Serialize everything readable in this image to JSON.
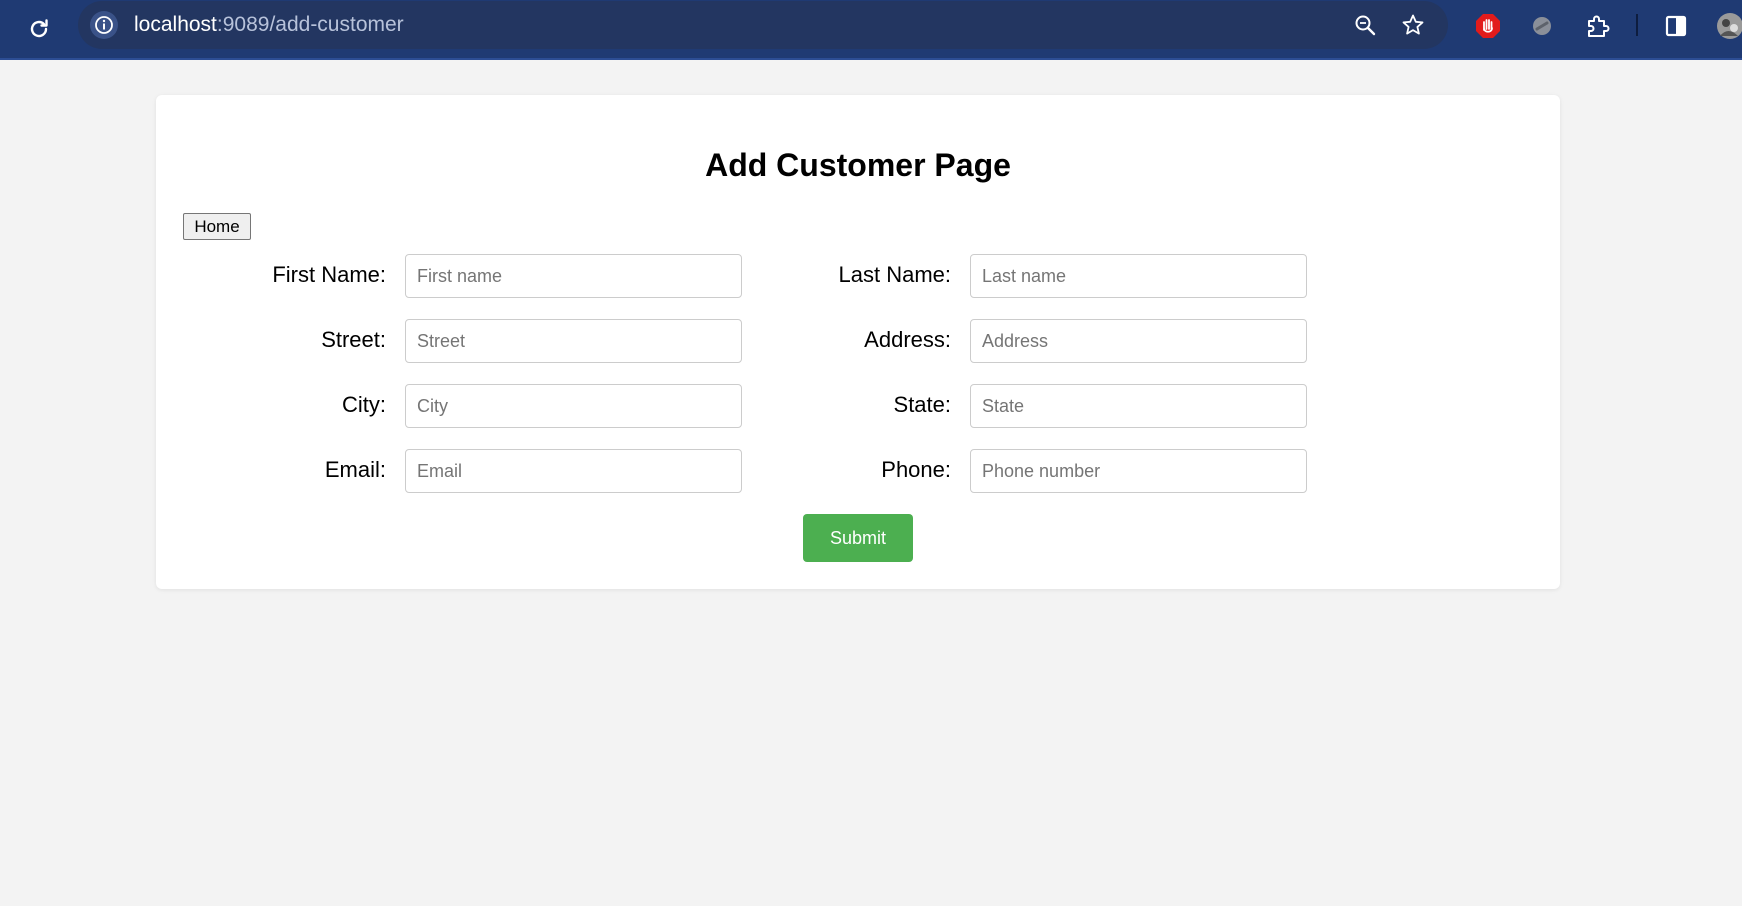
{
  "browser": {
    "url_host": "localhost",
    "url_path": ":9089/add-customer",
    "icons": {
      "reload": "reload-icon",
      "info": "info-icon",
      "zoom": "zoom-icon",
      "bookmark": "bookmark-star-icon",
      "extension1": "stop-hand-extension-icon",
      "extension2": "gray-extension-icon",
      "extensions": "puzzle-extensions-icon",
      "sidepanel": "side-panel-icon",
      "profile": "profile-avatar-icon"
    }
  },
  "page": {
    "title": "Add Customer Page",
    "home_button": "Home",
    "submit_button": "Submit",
    "fields": {
      "first_name": {
        "label": "First Name:",
        "placeholder": "First name"
      },
      "last_name": {
        "label": "Last Name:",
        "placeholder": "Last name"
      },
      "street": {
        "label": "Street:",
        "placeholder": "Street"
      },
      "address": {
        "label": "Address:",
        "placeholder": "Address"
      },
      "city": {
        "label": "City:",
        "placeholder": "City"
      },
      "state": {
        "label": "State:",
        "placeholder": "State"
      },
      "email": {
        "label": "Email:",
        "placeholder": "Email"
      },
      "phone": {
        "label": "Phone:",
        "placeholder": "Phone number"
      }
    }
  },
  "colors": {
    "toolbar_bg": "#1f3a73",
    "submit_green": "#4caf50",
    "page_bg": "#f3f3f3"
  }
}
